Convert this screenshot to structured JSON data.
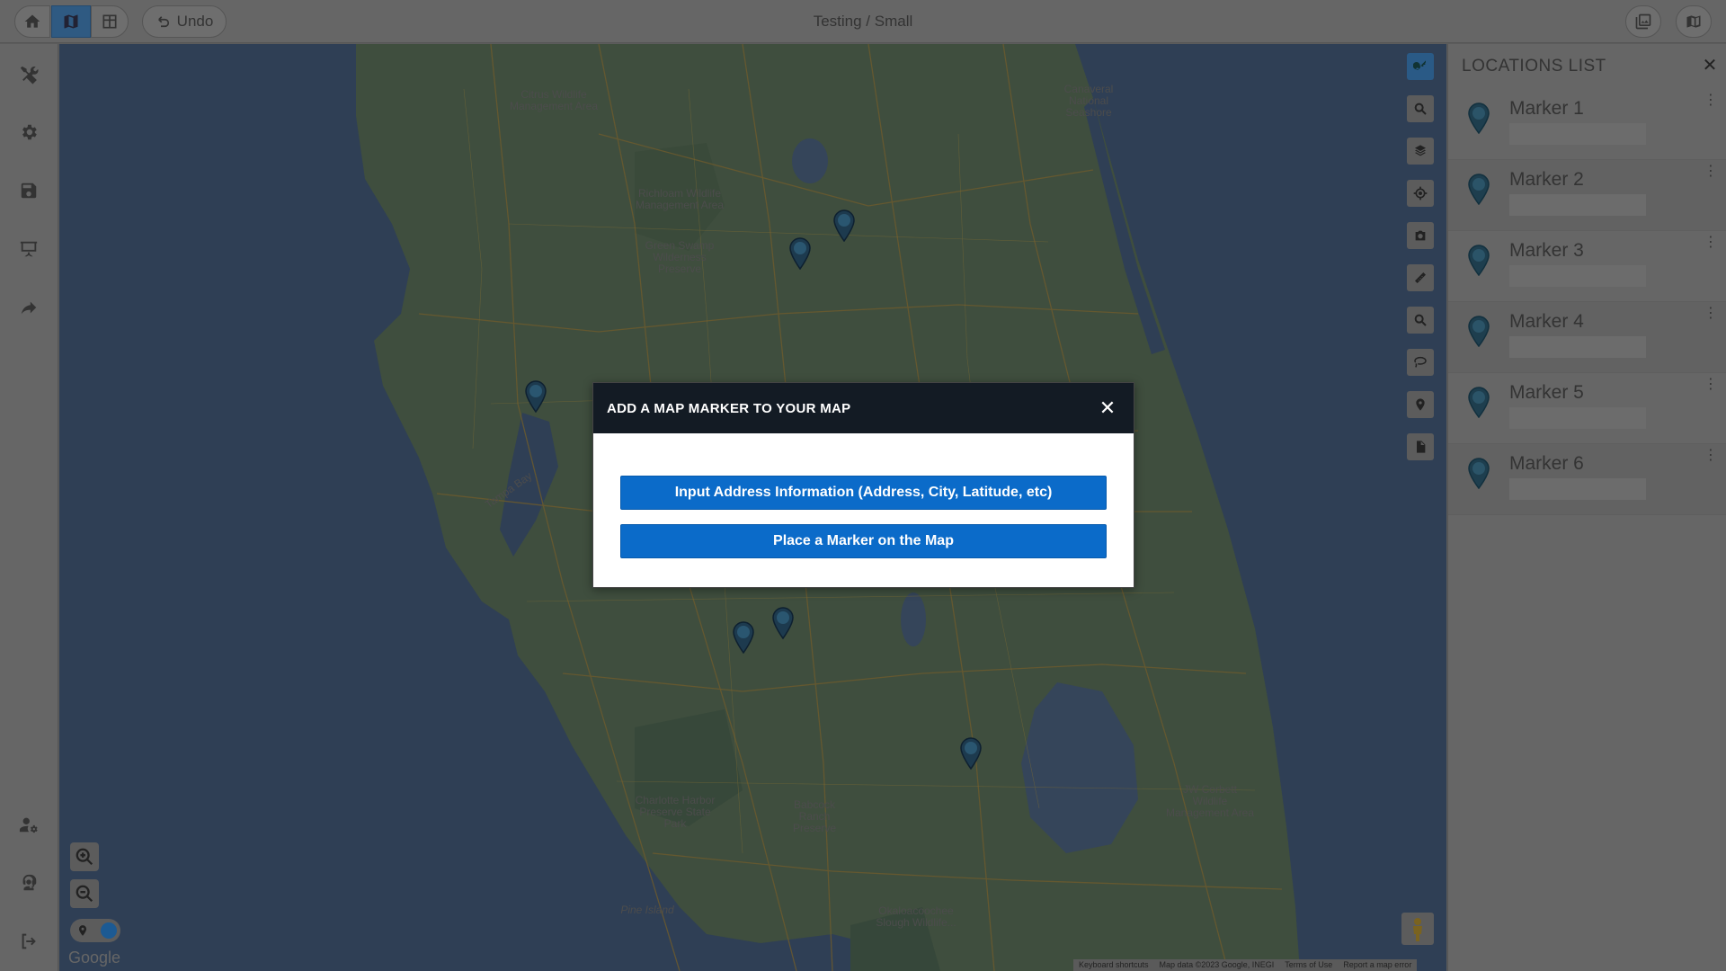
{
  "header": {
    "title": "Testing / Small",
    "undo_label": "Undo",
    "home_icon": "home-icon",
    "map_icon": "map-icon",
    "table_icon": "table-icon"
  },
  "sidebar": {
    "items": [
      {
        "name": "tools-icon"
      },
      {
        "name": "gear-icon"
      },
      {
        "name": "save-icon"
      },
      {
        "name": "presentation-icon"
      },
      {
        "name": "share-icon"
      },
      {
        "name": "user-settings-icon"
      },
      {
        "name": "support-agent-icon"
      },
      {
        "name": "logout-icon"
      }
    ]
  },
  "map": {
    "labels": [
      "Citrus Wildlife Management Area",
      "Richloam Wildlife Management Area",
      "Green Swamp Wilderness Preserve",
      "Canaveral National Seashore",
      "Tampa Bay",
      "Charlotte Harbor Preserve State Park",
      "Babcock Ranch Preserve",
      "JW Corbett Wildlife Management Area",
      "Pine Island",
      "Okaloacoochee Slough Wildlife..."
    ],
    "google_logo": "Google",
    "attribution": {
      "keyboard": "Keyboard shortcuts",
      "data": "Map data ©2023 Google, INEGI",
      "terms": "Terms of Use",
      "report": "Report a map error"
    },
    "colors": {
      "accent": "#0b6bc9",
      "active_tool": "#2a5a86"
    }
  },
  "locations": {
    "title": "LOCATIONS LIST",
    "items": [
      {
        "name": "Marker 1"
      },
      {
        "name": "Marker 2"
      },
      {
        "name": "Marker 3"
      },
      {
        "name": "Marker 4"
      },
      {
        "name": "Marker 5"
      },
      {
        "name": "Marker 6"
      }
    ]
  },
  "dialog": {
    "title": "ADD A MAP MARKER TO YOUR MAP",
    "close_label": "✕",
    "input_address_label": "Input Address Information (Address, City, Latitude, etc)",
    "place_marker_label": "Place a Marker on the Map"
  }
}
